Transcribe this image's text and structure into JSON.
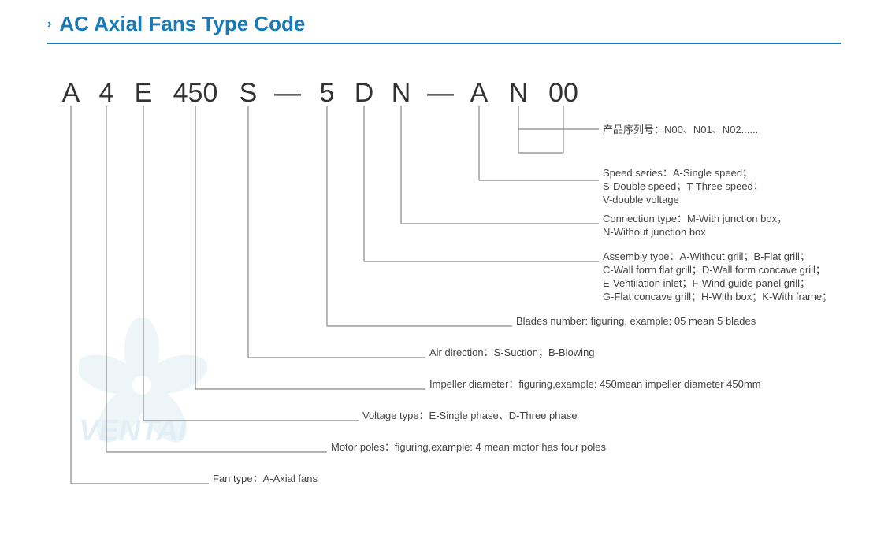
{
  "header": {
    "chevron": "›",
    "title": "AC Axial Fans Type Code",
    "divider": true
  },
  "type_code": {
    "letters": [
      "A",
      "4",
      "E",
      "450",
      "S",
      "—",
      "5",
      "D",
      "N",
      "—",
      "A",
      "N",
      "00"
    ]
  },
  "annotations": {
    "product_series": {
      "label": "产品序列号：N00、N01、N02......",
      "connector_from_letter": "00"
    },
    "speed_series": {
      "label": "Speed series：A-Single speed；",
      "label2": "S-Double speed；T-Three speed；",
      "label3": "V-double voltage",
      "connector_from_letter": "A"
    },
    "connection_type": {
      "label": "Connection type：M-With junction box，",
      "label2": "N-Without junction box",
      "connector_from_letter": "N"
    },
    "assembly_type": {
      "label": "Assembly type：A-Without grill；B-Flat grill；",
      "label2": "C-Wall form flat grill；D-Wall form concave grill；",
      "label3": "E-Ventilation inlet；F-Wind guide panel grill；",
      "label4": "G-Flat concave grill；H-With box；K-With frame；",
      "connector_from_letter": "D"
    },
    "blades_number": {
      "label": "Blades number: figuring, example: 05 mean 5 blades",
      "connector_from_letter": "5"
    },
    "air_direction": {
      "label": "Air direction：S-Suction；B-Blowing",
      "connector_from_letter": "S"
    },
    "impeller_diameter": {
      "label": "Impeller diameter：figuring,example: 450mean impeller diameter 450mm",
      "connector_from_letter": "450"
    },
    "voltage_type": {
      "label": "Voltage type：E-Single phase、D-Three phase",
      "connector_from_letter": "E"
    },
    "motor_poles": {
      "label": "Motor poles：figuring,example: 4 mean motor has four poles",
      "connector_from_letter": "4"
    },
    "fan_type": {
      "label": "Fan type：A-Axial fans",
      "connector_from_letter": "A_first"
    }
  },
  "watermark": {
    "text": "VENTAI"
  },
  "colors": {
    "blue": "#1a7ab5",
    "dark": "#333333",
    "line": "#555555",
    "text": "#444444"
  }
}
